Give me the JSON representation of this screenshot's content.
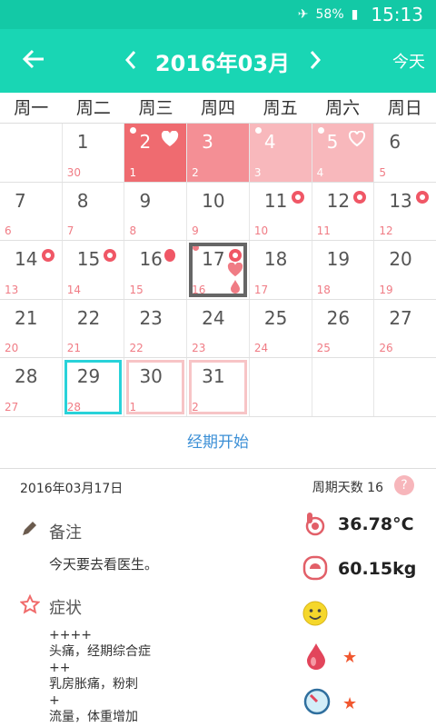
{
  "status": {
    "battery": "58%",
    "time": "15:13"
  },
  "appbar": {
    "title": "2016年03月",
    "today": "今天"
  },
  "weekdays": [
    "周一",
    "周二",
    "周三",
    "周四",
    "周五",
    "周六",
    "周日"
  ],
  "calendar": [
    [
      {
        "d": "",
        "l": ""
      },
      {
        "d": "1",
        "l": "30"
      },
      {
        "d": "2",
        "l": "1",
        "style": "period1",
        "dot": true,
        "icon": "heart-icon"
      },
      {
        "d": "3",
        "l": "2",
        "style": "period2"
      },
      {
        "d": "4",
        "l": "3",
        "style": "period3",
        "dot": true
      },
      {
        "d": "5",
        "l": "4",
        "style": "period3",
        "dot": true,
        "icon": "heart-outline-icon"
      },
      {
        "d": "6",
        "l": "5"
      }
    ],
    [
      {
        "d": "7",
        "l": "6"
      },
      {
        "d": "8",
        "l": "7"
      },
      {
        "d": "9",
        "l": "8"
      },
      {
        "d": "10",
        "l": "9"
      },
      {
        "d": "11",
        "l": "10",
        "icon": "flower-icon"
      },
      {
        "d": "12",
        "l": "11",
        "icon": "flower-icon"
      },
      {
        "d": "13",
        "l": "12",
        "icon": "flower-icon"
      }
    ],
    [
      {
        "d": "14",
        "l": "13",
        "icon": "flower-icon"
      },
      {
        "d": "15",
        "l": "14",
        "icon": "flower-icon"
      },
      {
        "d": "16",
        "l": "15",
        "icon": "drop-icon"
      },
      {
        "d": "17",
        "l": "16",
        "icon": "flower-icon",
        "today": true,
        "dot": true
      },
      {
        "d": "18",
        "l": "17"
      },
      {
        "d": "19",
        "l": "18"
      },
      {
        "d": "20",
        "l": "19"
      }
    ],
    [
      {
        "d": "21",
        "l": "20"
      },
      {
        "d": "22",
        "l": "21"
      },
      {
        "d": "23",
        "l": "22"
      },
      {
        "d": "24",
        "l": "23"
      },
      {
        "d": "25",
        "l": "24"
      },
      {
        "d": "26",
        "l": "25"
      },
      {
        "d": "27",
        "l": "26"
      }
    ],
    [
      {
        "d": "28",
        "l": "27"
      },
      {
        "d": "29",
        "l": "28",
        "sel": true
      },
      {
        "d": "30",
        "l": "1",
        "pred": true
      },
      {
        "d": "31",
        "l": "2",
        "pred": true
      },
      {
        "d": "",
        "l": ""
      },
      {
        "d": "",
        "l": ""
      },
      {
        "d": "",
        "l": ""
      }
    ]
  ],
  "action_label": "经期开始",
  "detail": {
    "date": "2016年03月17日",
    "cycle_label": "周期天数 16",
    "help_symbol": "?",
    "note_label": "备注",
    "note_text": "今天要去看医生。",
    "symptom_label": "症状",
    "symptoms": [
      {
        "level": "++++",
        "text": "头痛，经期综合症"
      },
      {
        "level": "++",
        "text": "乳房胀痛，粉刺"
      },
      {
        "level": "+",
        "text": "流量，体重增加"
      }
    ],
    "temperature": "36.78°C",
    "weight": "60.15kg"
  },
  "colors": {
    "accent": "#19d6b4",
    "period": "#ef6b70",
    "link": "#3b8fd6",
    "star": "#f1572f"
  }
}
